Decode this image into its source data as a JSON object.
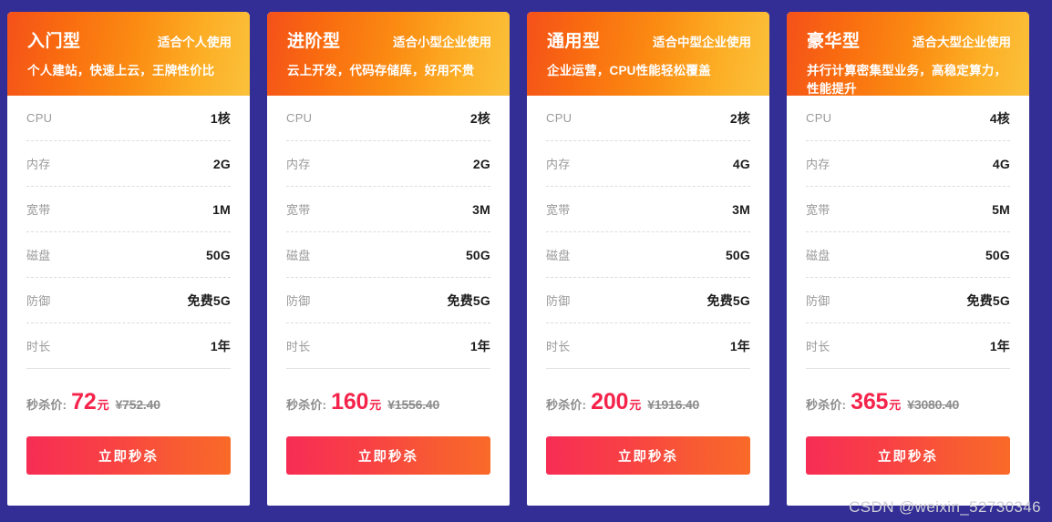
{
  "background_color": "#332D96",
  "accent_colors": {
    "header_gradient_start": "#F4511A",
    "header_gradient_end": "#FBC13B",
    "price_red": "#F5234A",
    "cta_gradient_start": "#F72D55",
    "cta_gradient_end": "#F96A28"
  },
  "spec_labels": [
    "CPU",
    "内存",
    "宽带",
    "磁盘",
    "防御",
    "时长"
  ],
  "price_caption": "秒杀价:",
  "price_unit": "元",
  "currency_symbol": "¥",
  "cta_label": "立即秒杀",
  "watermark": "CSDN @weixin_52730346",
  "cards": [
    {
      "name": "入门型",
      "audience": "适合个人使用",
      "description": "个人建站，快速上云，王牌性价比",
      "specs": {
        "cpu": "1核",
        "memory": "2G",
        "bandwidth": "1M",
        "disk": "50G",
        "defense": "免费5G",
        "duration": "1年"
      },
      "sale_price": "72",
      "original_price": "752.40"
    },
    {
      "name": "进阶型",
      "audience": "适合小型企业使用",
      "description": "云上开发，代码存储库，好用不贵",
      "specs": {
        "cpu": "2核",
        "memory": "2G",
        "bandwidth": "3M",
        "disk": "50G",
        "defense": "免费5G",
        "duration": "1年"
      },
      "sale_price": "160",
      "original_price": "1556.40"
    },
    {
      "name": "通用型",
      "audience": "适合中型企业使用",
      "description": "企业运营，CPU性能轻松覆盖",
      "specs": {
        "cpu": "2核",
        "memory": "4G",
        "bandwidth": "3M",
        "disk": "50G",
        "defense": "免费5G",
        "duration": "1年"
      },
      "sale_price": "200",
      "original_price": "1916.40"
    },
    {
      "name": "豪华型",
      "audience": "适合大型企业使用",
      "description": "并行计算密集型业务，高稳定算力，性能提升",
      "specs": {
        "cpu": "4核",
        "memory": "4G",
        "bandwidth": "5M",
        "disk": "50G",
        "defense": "免费5G",
        "duration": "1年"
      },
      "sale_price": "365",
      "original_price": "3080.40"
    }
  ]
}
